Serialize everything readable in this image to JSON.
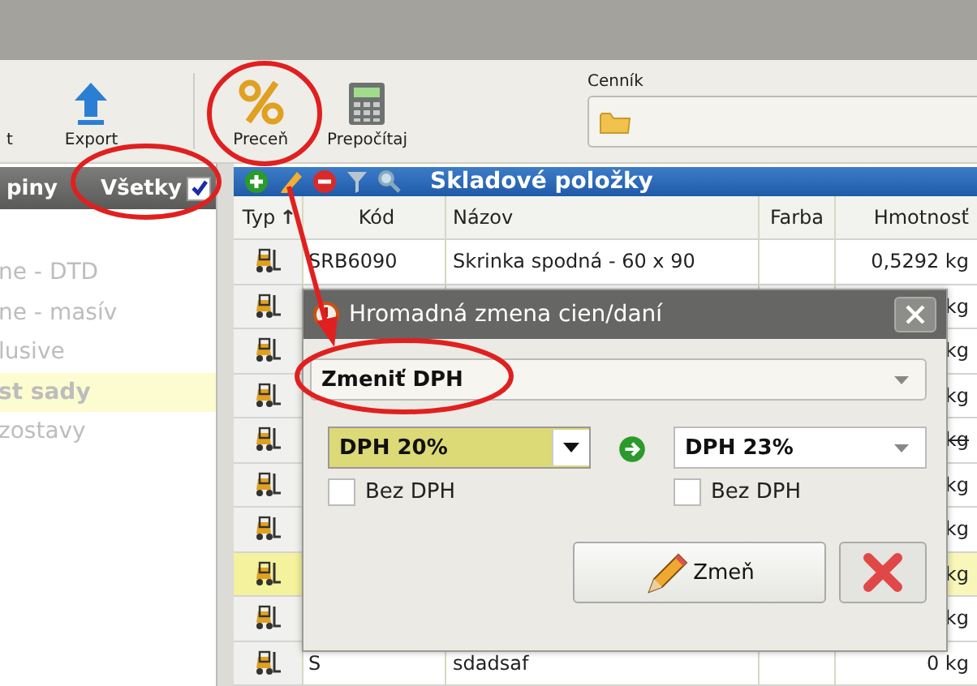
{
  "toolbar": {
    "buttons": [
      {
        "label": "t",
        "kind": "plain"
      },
      {
        "label": "Export",
        "kind": "export"
      },
      {
        "label": "Preceň",
        "kind": "percent"
      },
      {
        "label": "Prepočítaj",
        "kind": "calculator"
      }
    ],
    "pricelist": {
      "label": "Cenník"
    }
  },
  "groups": {
    "title": "piny",
    "all_label": "Všetky",
    "all_checked": true,
    "items": [
      {
        "label": "ne - DTD",
        "selected": false
      },
      {
        "label": "ne - masív",
        "selected": false
      },
      {
        "label": "lusive",
        "selected": false
      },
      {
        "label": "st sady",
        "selected": true
      },
      {
        "label": "zostavy",
        "selected": false
      }
    ]
  },
  "grid": {
    "title": "Skladové položky",
    "columns": [
      "Typ",
      "Kód",
      "Názov",
      "Farba",
      "Hmotnosť"
    ],
    "rows": [
      {
        "code": "SRB6090",
        "name": "Skrinka spodná - 60 x 90",
        "weight": "0,5292 kg",
        "selected": false,
        "struck": false
      },
      {
        "weight": "kg",
        "selected": false,
        "struck": false
      },
      {
        "weight": "kg",
        "selected": false,
        "struck": false
      },
      {
        "weight": "kg",
        "selected": false,
        "struck": false
      },
      {
        "weight": "kg",
        "selected": false,
        "struck": true
      },
      {
        "weight": "kg",
        "selected": false,
        "struck": false
      },
      {
        "weight": "kg",
        "selected": false,
        "struck": false
      },
      {
        "weight": "kg",
        "selected": true,
        "struck": false
      },
      {
        "weight": "kg",
        "selected": false,
        "struck": false
      },
      {
        "code": "S",
        "name": "sdadsaf",
        "weight": "0 kg",
        "selected": false,
        "struck": false
      }
    ]
  },
  "dialog": {
    "title": "Hromadná zmena cien/daní",
    "action": "Zmeniť DPH",
    "from": {
      "value": "DPH 20%",
      "without_vat_label": "Bez DPH",
      "without_vat": false
    },
    "to": {
      "value": "DPH 23%",
      "without_vat_label": "Bez DPH",
      "without_vat": false
    },
    "confirm": "Zmeň"
  }
}
